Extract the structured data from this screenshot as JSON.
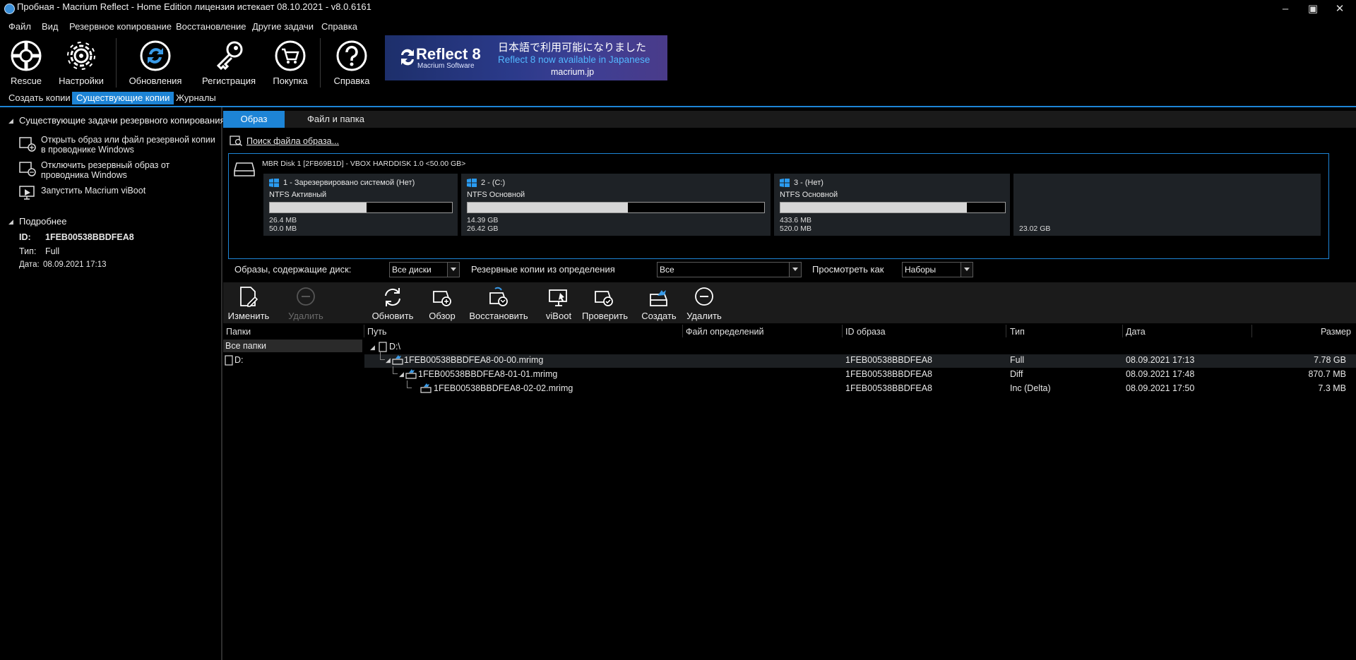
{
  "window": {
    "title": "Пробная - Macrium Reflect - Home Edition лицензия истекает 08.10.2021 - v8.0.6161",
    "minimize": "–",
    "restore": "▣",
    "close": "✕"
  },
  "menu": [
    "Файл",
    "Вид",
    "Резервное копирование",
    "Восстановление",
    "Другие задачи",
    "Справка"
  ],
  "ribbon": {
    "buttons": [
      "Rescue",
      "Настройки",
      "Обновления",
      "Регистрация",
      "Покупка",
      "Справка"
    ]
  },
  "banner": {
    "brand": "Reflect 8",
    "sub": "Macrium Software",
    "jp": "日本語で利用可能になりました",
    "en": "Reflect 8 now available in Japanese",
    "url": "macrium.jp"
  },
  "tabs": [
    "Создать копии",
    "Существующие копии",
    "Журналы"
  ],
  "left": {
    "tasks_header": "Существующие задачи резервного копирования",
    "tasks": [
      "Открыть образ или файл резервной копии в проводнике Windows",
      "Отключить резервный образ от проводника Windows",
      "Запустить Macrium viBoot"
    ],
    "details_header": "Подробнее",
    "id_label": "ID:",
    "id_value": "1FEB00538BBDFEA8",
    "type_label": "Тип:",
    "type_value": "Full",
    "date_label": "Дата:",
    "date_value": "08.09.2021 17:13"
  },
  "subtabs": [
    "Образ",
    "Файл и папка"
  ],
  "search_link": "Поиск файла образа...",
  "disk": {
    "header": "MBR Disk 1 [2FB69B1D] - VBOX HARDDISK 1.0  <50.00 GB>",
    "partitions": [
      {
        "name": "1 - Зарезервировано системой (Нет)",
        "fs": "NTFS Активный",
        "used": "26.4 MB",
        "total": "50.0 MB",
        "fill": 0.53
      },
      {
        "name": "2 -  (C:)",
        "fs": "NTFS Основной",
        "used": "14.39 GB",
        "total": "26.42 GB",
        "fill": 0.54
      },
      {
        "name": "3 -  (Нет)",
        "fs": "NTFS Основной",
        "used": "433.6 MB",
        "total": "520.0 MB",
        "fill": 0.83
      }
    ],
    "unallocated": "23.02 GB"
  },
  "filters": {
    "disk_label": "Образы, содержащие диск:",
    "disk_value": "Все диски",
    "def_label": "Резервные копии из определения",
    "def_value": "Все",
    "view_label": "Просмотреть как",
    "view_value": "Наборы"
  },
  "toolbar": [
    "Изменить",
    "Удалить",
    "Обновить",
    "Обзор",
    "Восстановить",
    "viBoot",
    "Проверить",
    "Создать",
    "Удалить"
  ],
  "table": {
    "headers": [
      "Папки",
      "Путь",
      "Файл определений",
      "ID образа",
      "Тип",
      "Дата",
      "Размер"
    ],
    "folders": [
      "Все папки",
      "D:"
    ],
    "root": "D:\\",
    "rows": [
      {
        "path": "1FEB00538BBDFEA8-00-00.mrimg",
        "id": "1FEB00538BBDFEA8",
        "type": "Full",
        "date": "08.09.2021 17:13",
        "size": "7.78 GB"
      },
      {
        "path": "1FEB00538BBDFEA8-01-01.mrimg",
        "id": "1FEB00538BBDFEA8",
        "type": "Diff",
        "date": "08.09.2021 17:48",
        "size": "870.7 MB"
      },
      {
        "path": "1FEB00538BBDFEA8-02-02.mrimg",
        "id": "1FEB00538BBDFEA8",
        "type": "Inc (Delta)",
        "date": "08.09.2021 17:50",
        "size": "7.3 MB"
      }
    ]
  },
  "colors": {
    "accent": "#1d84d6",
    "background": "#000000",
    "panel": "#1e2226"
  }
}
